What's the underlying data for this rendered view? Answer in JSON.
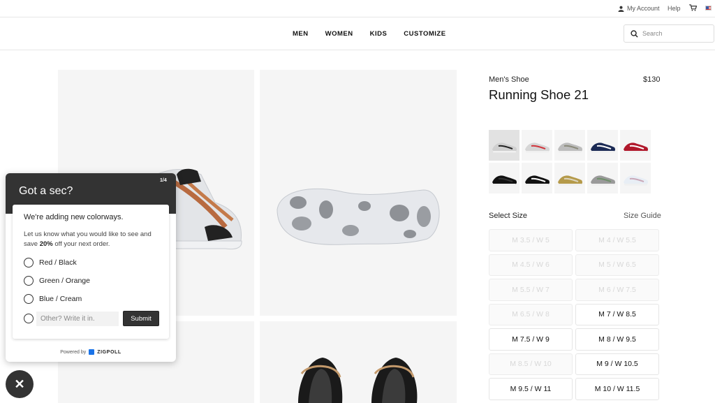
{
  "utility": {
    "account_label": "My Account",
    "help_label": "Help"
  },
  "nav": {
    "links": [
      "MEN",
      "WOMEN",
      "KIDS",
      "CUSTOMIZE"
    ],
    "search_placeholder": "Search"
  },
  "product": {
    "category": "Men's Shoe",
    "price": "$130",
    "name": "Running Shoe 21",
    "colorways": [
      {
        "colors": [
          "#cfcfcf",
          "#222222"
        ]
      },
      {
        "colors": [
          "#d6d6d6",
          "#d1343b"
        ]
      },
      {
        "colors": [
          "#bdbdbd",
          "#8a8a7a"
        ]
      },
      {
        "colors": [
          "#1b2a55",
          "#ffffff"
        ]
      },
      {
        "colors": [
          "#b0182b",
          "#ffffff"
        ]
      },
      {
        "colors": [
          "#111111",
          "#333333"
        ]
      },
      {
        "colors": [
          "#111111",
          "#ffffff"
        ]
      },
      {
        "colors": [
          "#b59a4a",
          "#ddd6bf"
        ]
      },
      {
        "colors": [
          "#9a9a9a",
          "#6f8f6a"
        ]
      },
      {
        "colors": [
          "#e8eef5",
          "#c9a8b8"
        ]
      }
    ],
    "select_size_label": "Select Size",
    "size_guide_label": "Size Guide",
    "sizes": [
      {
        "label": "M 3.5 / W 5",
        "available": false
      },
      {
        "label": "M 4 / W 5.5",
        "available": false
      },
      {
        "label": "M 4.5 / W 6",
        "available": false
      },
      {
        "label": "M 5 / W 6.5",
        "available": false
      },
      {
        "label": "M 5.5 / W 7",
        "available": false
      },
      {
        "label": "M 6 / W 7.5",
        "available": false
      },
      {
        "label": "M 6.5 / W 8",
        "available": false
      },
      {
        "label": "M 7 / W 8.5",
        "available": true
      },
      {
        "label": "M 7.5 / W 9",
        "available": true
      },
      {
        "label": "M 8 / W 9.5",
        "available": true
      },
      {
        "label": "M 8.5 / W 10",
        "available": false
      },
      {
        "label": "M 9 / W 10.5",
        "available": true
      },
      {
        "label": "M 9.5 / W 11",
        "available": true
      },
      {
        "label": "M 10 / W 11.5",
        "available": true
      }
    ]
  },
  "survey": {
    "title": "Got a sec?",
    "step": "1/4",
    "question": "We're adding new colorways.",
    "description_before": "Let us know what you would like to see and save ",
    "description_bold": "20%",
    "description_after": " off your next order.",
    "options": [
      "Red / Black",
      "Green / Orange",
      "Blue / Cream"
    ],
    "other_placeholder": "Other? Write it in.",
    "submit_label": "Submit",
    "powered_by": "Powered by",
    "brand": "ZIGPOLL"
  },
  "colors": {
    "popup_header": "#333333",
    "accent": "#111111"
  }
}
